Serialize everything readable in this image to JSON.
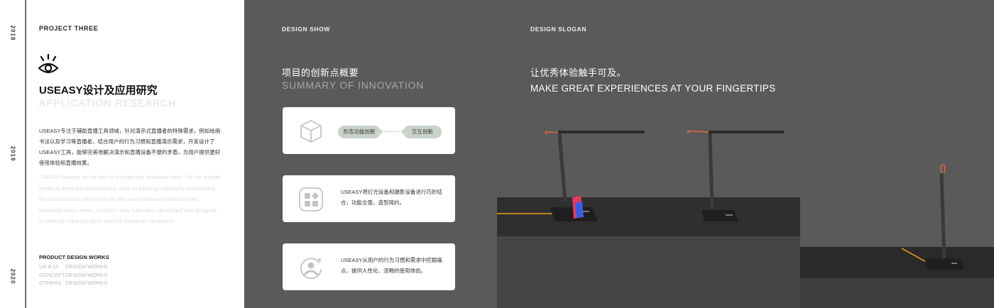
{
  "years": [
    "2018",
    "2019",
    "2020"
  ],
  "left": {
    "project_label": "PROJECT THREE",
    "title_cn": "USEASY设计及应用研究",
    "title_en": "APPLICATION RESEARCH",
    "desc_cn": "USEASY专注于辅助直播工具领域，针对演示式直播者的特殊需求，例如绘画书法以及学习等直播者，结合用户的行为习惯和直播演示需求，开发设计了USEASY工具，能够完美地解决演示和直播设备不便的矛盾，为用户提供更好使用体验和直播效果。",
    "desc_en": "USEASY focuses on the field of assisted live broadcast tools. For the special needs of demo live broadcasters, such as painting calligraphy and learning live broadcasters, combined with the user's behavior habits and live broadcast demo needs, USEASY tools have been developed and designed to perfectly solve the demo and live broadcast equipment.",
    "works_title": "PRODUCT DESIGN WORKS",
    "works": [
      {
        "a": "UX & UI",
        "b": "DESIGN WORKS"
      },
      {
        "a": "CONCEPT",
        "b": "DESIGN WORKS"
      },
      {
        "a": "OTHERS",
        "b": "DESIGN WORKS"
      }
    ]
  },
  "middle": {
    "label": "DESIGN SHOW",
    "title_cn": "项目的创新点概要",
    "title_en": "SUMMARY OF INNOVATION",
    "card1": {
      "icon": "cube-icon",
      "pill1": "形态功能创新",
      "pill2": "交互创新"
    },
    "card2": {
      "icon": "app-grid-icon",
      "text": "USEASY将灯光设备和摄影设备进行巧妙结合，功能全面，造型简约。"
    },
    "card3": {
      "icon": "user-behavior-icon",
      "text": "USEASY从用户的行为习惯和需求中挖掘痛点，提供人性化、流畅的使用体验。"
    }
  },
  "right": {
    "label": "DESIGN SLOGAN",
    "title_cn": "让优秀体验触手可及。",
    "title_en": "MAKE GREAT EXPERIENCES AT YOUR FINGERTIPS"
  },
  "colors": {
    "background": "#5a5a5a",
    "panel": "#ffffff",
    "pill": "#c9d3c9",
    "accent_cable": "#f0a020",
    "accent_cord": "#e06a3c"
  }
}
